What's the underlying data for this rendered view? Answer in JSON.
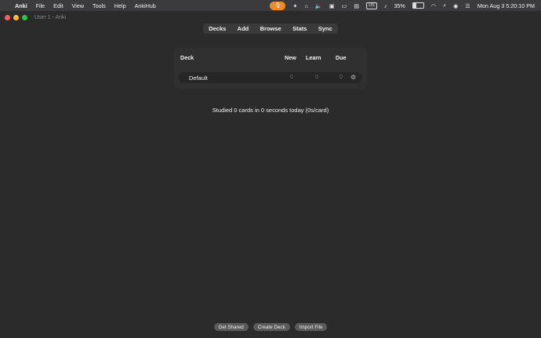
{
  "menubar": {
    "apple": "",
    "app_name": "Anki",
    "items": [
      "File",
      "Edit",
      "View",
      "Tools",
      "Help",
      "AnkiHub"
    ],
    "keyboard_badge": "US",
    "battery": "35%",
    "battery_level": 0.35,
    "datetime": "Mon Aug 3   5:20:10 PM"
  },
  "window": {
    "title": "User 1 - Anki"
  },
  "toolbar": {
    "decks": "Decks",
    "add": "Add",
    "browse": "Browse",
    "stats": "Stats",
    "sync": "Sync"
  },
  "deck_table": {
    "headers": {
      "deck": "Deck",
      "new": "New",
      "learn": "Learn",
      "due": "Due"
    },
    "rows": [
      {
        "name": "Default",
        "new": "0",
        "learn": "0",
        "due": "0"
      }
    ]
  },
  "status": {
    "studied": "Studied 0 cards in 0 seconds today (0s/card)"
  },
  "bottom": {
    "get_shared": "Get Shared",
    "create_deck": "Create Deck",
    "import_file": "Import File"
  },
  "colors": {
    "background": "#2a2a2a",
    "panel": "#303030",
    "mic_accent": "#f08a24",
    "close": "#ff5f57",
    "minimize": "#febc2e",
    "maximize": "#28c840"
  }
}
